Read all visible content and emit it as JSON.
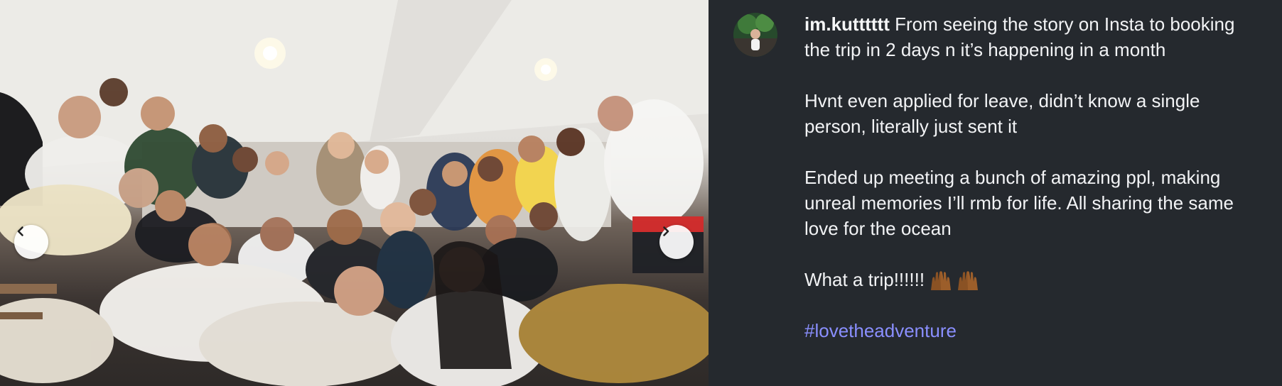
{
  "post": {
    "username": "im.kutttttt",
    "paragraphs": [
      "From seeing the story on Insta to booking the trip in 2 days n it’s happening in a month",
      "Hvnt even applied for leave, didn’t know a single person, literally just sent it",
      "Ended up meeting a bunch of amazing ppl, making unreal memories I’ll rmb for life. All sharing the same love for the ocean"
    ],
    "closing_text": "What a trip!!!!!!",
    "closing_emoji": [
      "raising-hands-dark",
      "raising-hands-dark"
    ],
    "hashtag": "#lovetheadventure"
  },
  "carousel": {
    "prev_icon": "chevron-left-icon",
    "next_icon": "chevron-right-icon"
  },
  "colors": {
    "panel_bg": "#25292e",
    "text": "#f2f3f5",
    "hashtag": "#8a8fff",
    "nav_button_bg": "#ffffff"
  }
}
